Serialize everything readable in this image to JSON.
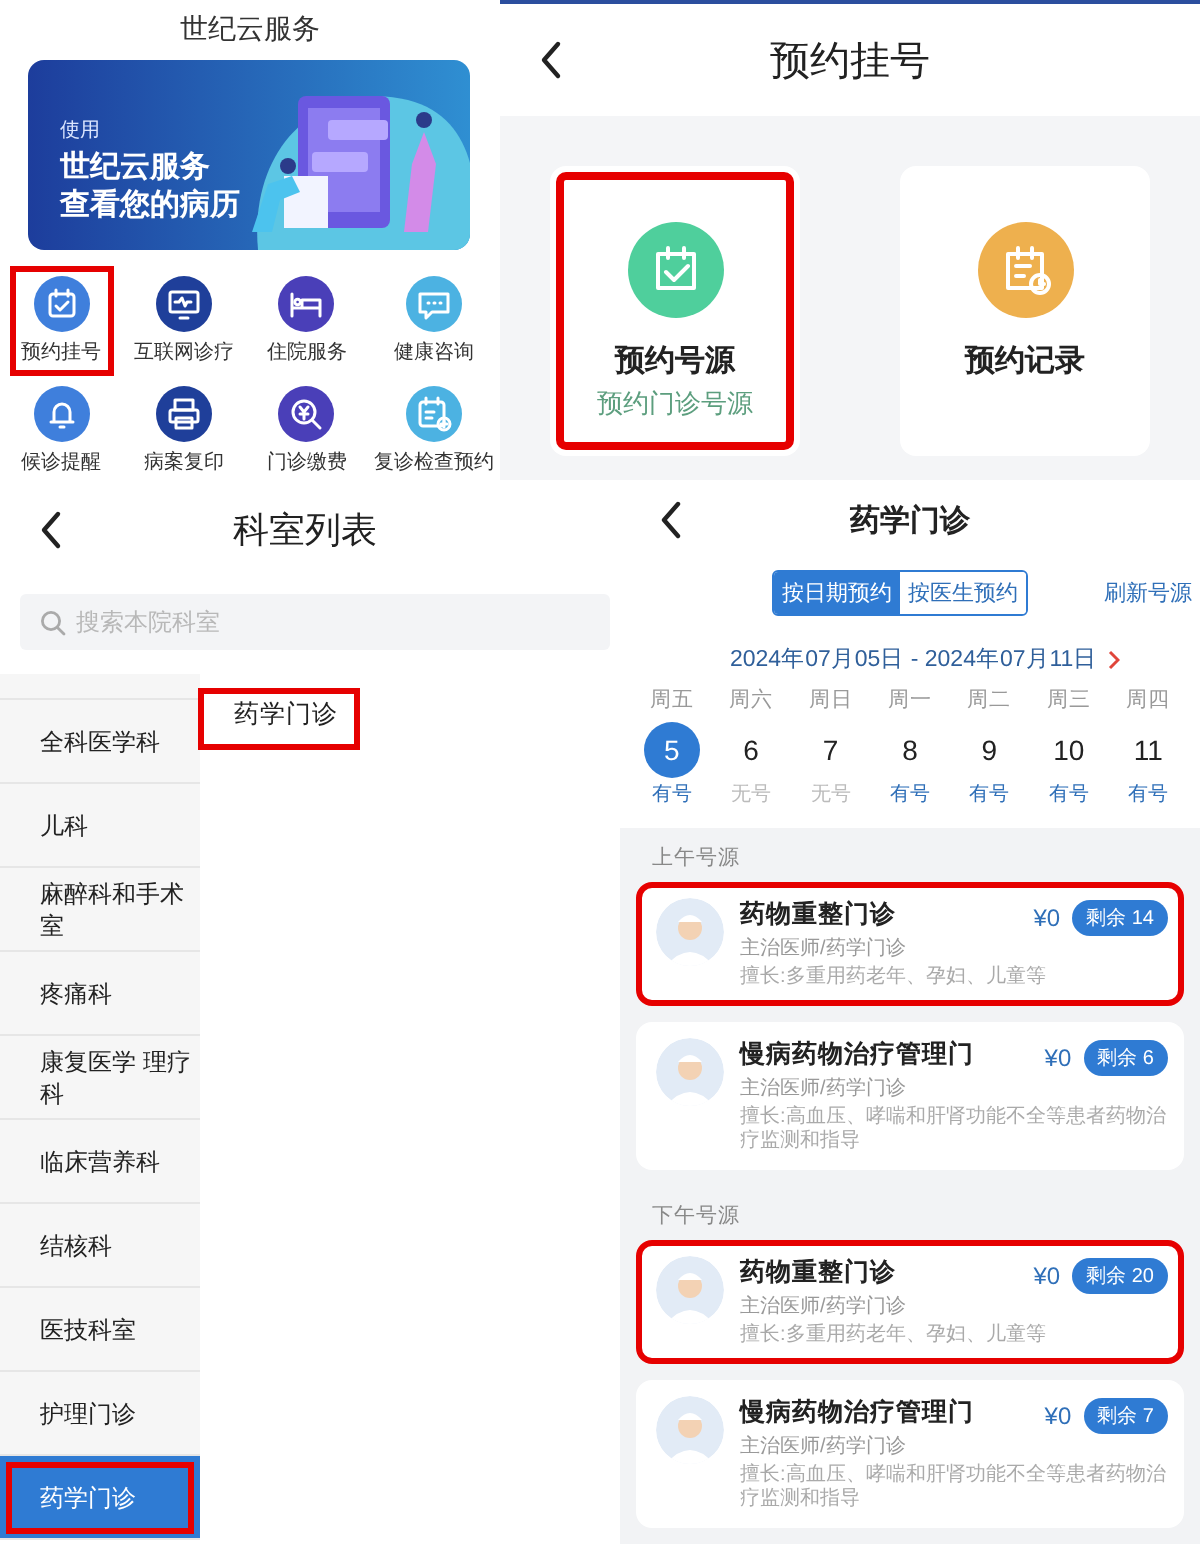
{
  "services": {
    "title": "世纪云服务",
    "banner": {
      "kicker": "使用",
      "lines": [
        "世纪云服务",
        "查看您的病历"
      ]
    },
    "items": [
      {
        "label": "预约挂号",
        "color": "#3f7fdc",
        "highlighted": true
      },
      {
        "label": "互联网诊疗",
        "color": "#1f3f9a",
        "highlighted": false
      },
      {
        "label": "住院服务",
        "color": "#4a3fb8",
        "highlighted": false
      },
      {
        "label": "健康咨询",
        "color": "#4cb2e2",
        "highlighted": false
      },
      {
        "label": "候诊提醒",
        "color": "#3f7fdc",
        "highlighted": false
      },
      {
        "label": "病案复印",
        "color": "#1f3f9a",
        "highlighted": false
      },
      {
        "label": "门诊缴费",
        "color": "#4a3fb8",
        "highlighted": false
      },
      {
        "label": "复诊检查预约",
        "color": "#4cb2e2",
        "highlighted": false
      }
    ]
  },
  "appointment": {
    "title": "预约挂号",
    "options": [
      {
        "title": "预约号源",
        "subtitle": "预约门诊号源",
        "color": "#4fcf9c",
        "highlighted": true
      },
      {
        "title": "预约记录",
        "color": "#eeb04e",
        "highlighted": false
      }
    ]
  },
  "departments": {
    "title": "科室列表",
    "search": {
      "placeholder": "搜索本院科室"
    },
    "sidebar": [
      {
        "label": "全科医学科",
        "selected": false,
        "highlighted": false
      },
      {
        "label": "儿科",
        "selected": false,
        "highlighted": false
      },
      {
        "label": "麻醉科和手术室",
        "selected": false,
        "highlighted": false
      },
      {
        "label": "疼痛科",
        "selected": false,
        "highlighted": false
      },
      {
        "label": "康复医学 理疗科",
        "selected": false,
        "highlighted": false
      },
      {
        "label": "临床营养科",
        "selected": false,
        "highlighted": false
      },
      {
        "label": "结核科",
        "selected": false,
        "highlighted": false
      },
      {
        "label": "医技科室",
        "selected": false,
        "highlighted": false
      },
      {
        "label": "护理门诊",
        "selected": false,
        "highlighted": false
      },
      {
        "label": "药学门诊",
        "selected": true,
        "highlighted": true
      }
    ],
    "results": [
      {
        "label": "药学门诊",
        "highlighted": true
      }
    ]
  },
  "schedule": {
    "title": "药学门诊",
    "modes": [
      {
        "label": "按日期预约",
        "selected": true
      },
      {
        "label": "按医生预约",
        "selected": false
      }
    ],
    "refresh": "刷新号源",
    "range": "2024年07月05日 - 2024年07月11日",
    "days": [
      {
        "weekday": "周五",
        "date": "5",
        "status": "有号",
        "available": true,
        "selected": true
      },
      {
        "weekday": "周六",
        "date": "6",
        "status": "无号",
        "available": false,
        "selected": false
      },
      {
        "weekday": "周日",
        "date": "7",
        "status": "无号",
        "available": false,
        "selected": false
      },
      {
        "weekday": "周一",
        "date": "8",
        "status": "有号",
        "available": true,
        "selected": false
      },
      {
        "weekday": "周二",
        "date": "9",
        "status": "有号",
        "available": true,
        "selected": false
      },
      {
        "weekday": "周三",
        "date": "10",
        "status": "有号",
        "available": true,
        "selected": false
      },
      {
        "weekday": "周四",
        "date": "11",
        "status": "有号",
        "available": true,
        "selected": false
      }
    ],
    "sections": [
      {
        "heading": "上午号源",
        "doctors": [
          {
            "name": "药物重整门诊",
            "title": "主治医师/药学门诊",
            "specialty": "擅长:多重用药老年、孕妇、儿童等",
            "price": "¥0",
            "remaining": "剩余 14",
            "highlighted": true
          },
          {
            "name": "慢病药物治疗管理门",
            "title": "主治医师/药学门诊",
            "specialty": "擅长:高血压、哮喘和肝肾功能不全等患者药物治疗监测和指导",
            "price": "¥0",
            "remaining": "剩余 6",
            "highlighted": false
          }
        ]
      },
      {
        "heading": "下午号源",
        "doctors": [
          {
            "name": "药物重整门诊",
            "title": "主治医师/药学门诊",
            "specialty": "擅长:多重用药老年、孕妇、儿童等",
            "price": "¥0",
            "remaining": "剩余 20",
            "highlighted": true
          },
          {
            "name": "慢病药物治疗管理门",
            "title": "主治医师/药学门诊",
            "specialty": "擅长:高血压、哮喘和肝肾功能不全等患者药物治疗监测和指导",
            "price": "¥0",
            "remaining": "剩余 7",
            "highlighted": false
          }
        ]
      }
    ]
  }
}
